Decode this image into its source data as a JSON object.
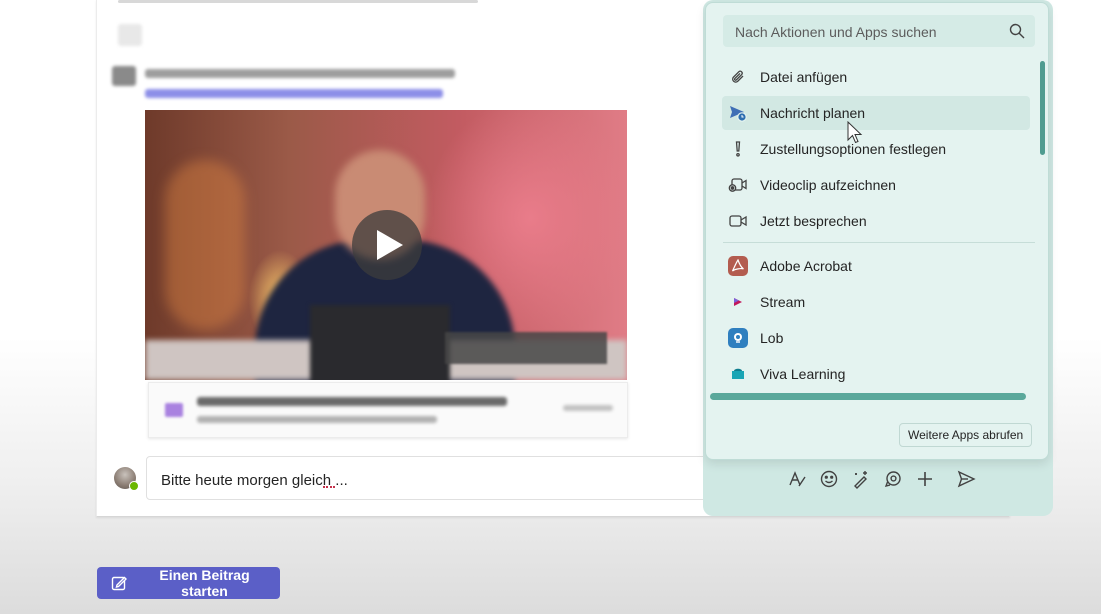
{
  "composer": {
    "text": "Bitte heute morgen gleich ..."
  },
  "popup": {
    "search_placeholder": "Nach Aktionen und Apps suchen",
    "actions": [
      {
        "label": "Datei anfügen",
        "icon": "paperclip-icon"
      },
      {
        "label": "Nachricht planen",
        "icon": "send-clock-icon"
      },
      {
        "label": "Zustellungsoptionen festlegen",
        "icon": "exclamation-icon"
      },
      {
        "label": "Videoclip aufzeichnen",
        "icon": "video-clip-icon"
      },
      {
        "label": "Jetzt besprechen",
        "icon": "video-camera-icon"
      }
    ],
    "apps": [
      {
        "label": "Adobe Acrobat",
        "icon": "adobe-acrobat-icon",
        "color": "#b35c4f"
      },
      {
        "label": "Stream",
        "icon": "stream-icon",
        "color": "#c2185b"
      },
      {
        "label": "Lob",
        "icon": "lob-icon",
        "color": "#2f7fbf"
      },
      {
        "label": "Viva Learning",
        "icon": "viva-learning-icon",
        "color": "#1aa5b5"
      }
    ],
    "more_apps_label": "Weitere Apps abrufen"
  },
  "new_post_label": "Einen Beitrag starten",
  "colors": {
    "accent": "#5b5fc7",
    "popup_background": "#e4f3f0",
    "scrollbar": "#5aa89b"
  }
}
